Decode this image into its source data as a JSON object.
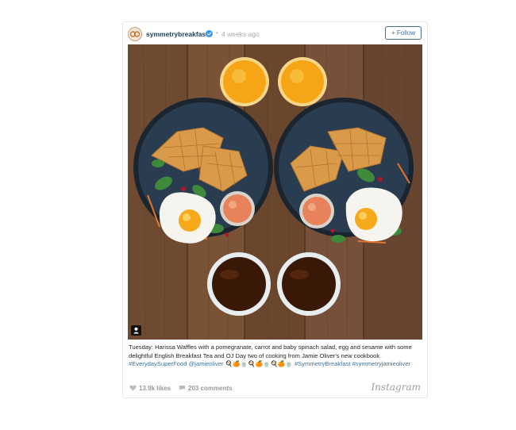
{
  "post": {
    "username": "symmetrybreakfast",
    "separator": "•",
    "time": "4 weeks ago",
    "follow_label": "+ Follow",
    "caption_text": "Tuesday: Harissa Waffles with a pomegranate, carrot and baby spinach salad, egg and sesame with some delightful English Breakfast Tea and OJ Day two of cooking from Jamie Oliver's new cookbook",
    "hashtag_1": "#EverydaySuperFood",
    "mention_1": "@jamieoliver",
    "emoji_text": "🍳🍊🍵🍳🍊🍵🍳🍊🍵",
    "hashtag_2": "#SymmetryBreakfast",
    "hashtag_3": "#symmetryjamieoliver",
    "likes": "13.9k likes",
    "comments": "203 comments",
    "brand": "Instagram"
  },
  "icons": {
    "verified": "verified-badge-icon",
    "heart": "heart-icon",
    "comment": "comment-icon",
    "photo_type": "photo-type-icon"
  },
  "colors": {
    "accent": "#3f729b",
    "verified": "#3897f0",
    "muted": "#999999"
  }
}
